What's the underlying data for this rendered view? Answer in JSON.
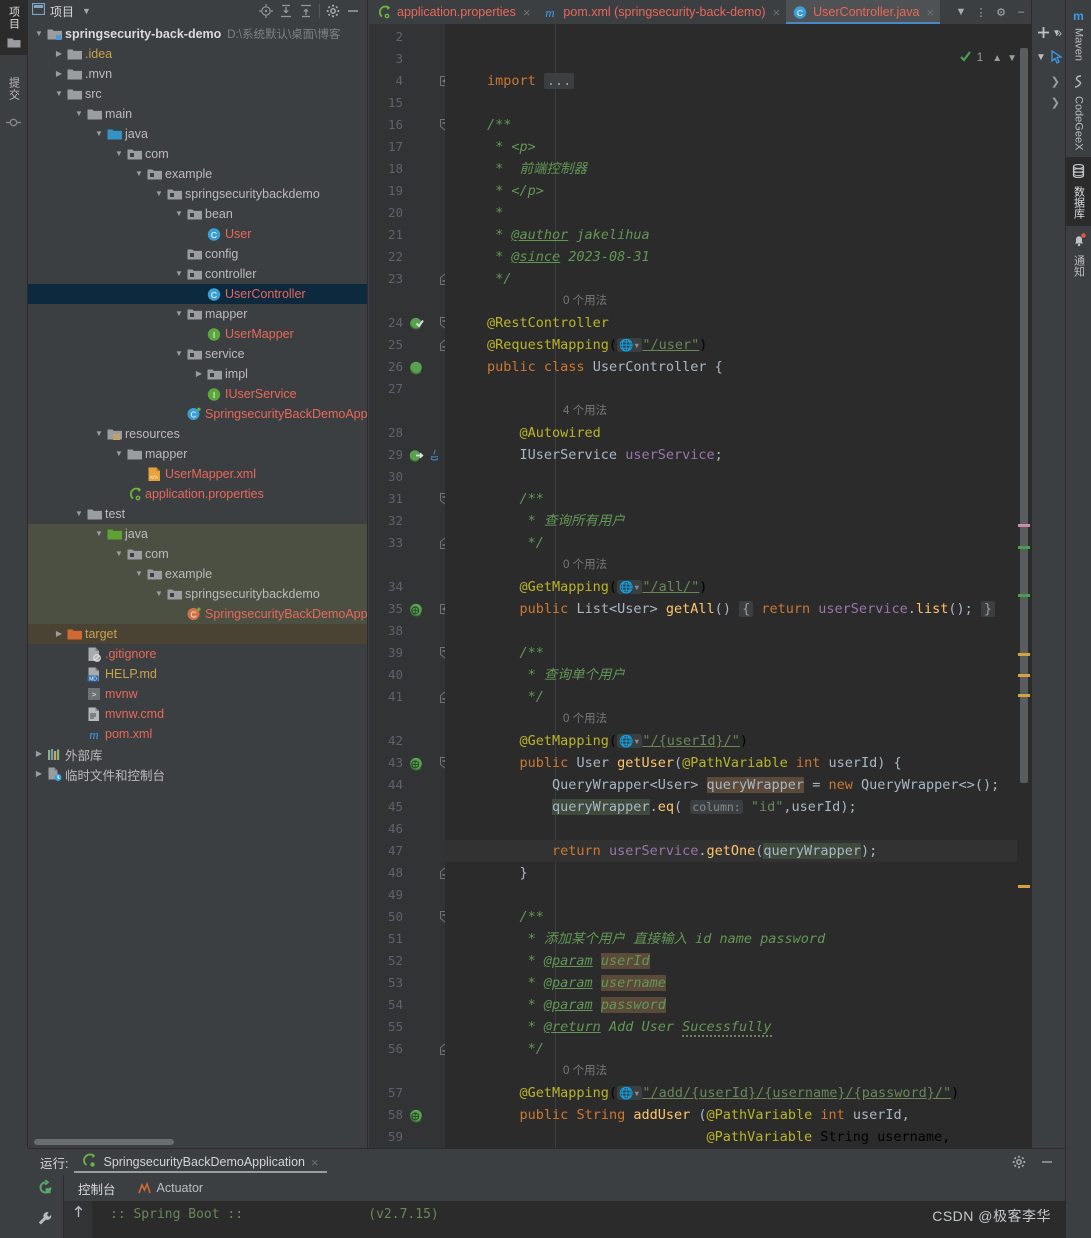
{
  "window": {
    "left_strip": [
      {
        "label": "项目",
        "icon": "project-icon",
        "active": true
      },
      {
        "label": "提交",
        "icon": "commit-icon",
        "active": false
      }
    ],
    "right_strip": [
      {
        "label": "Maven",
        "icon": "maven-icon"
      },
      {
        "label": "CodeGeeX",
        "icon": "codegeex-icon"
      },
      {
        "label": "数据库",
        "icon": "database-icon"
      },
      {
        "label": "通知",
        "icon": "bell-icon"
      }
    ]
  },
  "project_panel": {
    "title": "项目",
    "toolbar_icons": [
      "locate-icon",
      "expand-all-icon",
      "collapse-all-icon",
      "gear-icon",
      "minimize-icon"
    ],
    "tree": [
      {
        "depth": 0,
        "arrow": "down",
        "icon": "module-icon",
        "label": "springsecurity-back-demo",
        "sub": "D:\\系统默认\\桌面\\博客",
        "style": "bold"
      },
      {
        "depth": 1,
        "arrow": "right",
        "icon": "folder-icon",
        "label": ".idea",
        "style": "yellow"
      },
      {
        "depth": 1,
        "arrow": "right",
        "icon": "folder-icon",
        "label": ".mvn",
        "style": "plain"
      },
      {
        "depth": 1,
        "arrow": "down",
        "icon": "folder-icon",
        "label": "src",
        "style": "plain"
      },
      {
        "depth": 2,
        "arrow": "down",
        "icon": "folder-icon",
        "label": "main",
        "style": "plain"
      },
      {
        "depth": 3,
        "arrow": "down",
        "icon": "source-root-icon",
        "label": "java",
        "style": "plain"
      },
      {
        "depth": 4,
        "arrow": "down",
        "icon": "package-icon",
        "label": "com",
        "style": "plain"
      },
      {
        "depth": 5,
        "arrow": "down",
        "icon": "package-icon",
        "label": "example",
        "style": "plain"
      },
      {
        "depth": 6,
        "arrow": "down",
        "icon": "package-icon",
        "label": "springsecuritybackdemo",
        "style": "plain"
      },
      {
        "depth": 7,
        "arrow": "down",
        "icon": "package-icon",
        "label": "bean",
        "style": "plain"
      },
      {
        "depth": 8,
        "arrow": "none",
        "icon": "class-icon",
        "label": "User",
        "style": "salmon"
      },
      {
        "depth": 7,
        "arrow": "none",
        "icon": "package-icon",
        "label": "config",
        "style": "plain"
      },
      {
        "depth": 7,
        "arrow": "down",
        "icon": "package-icon",
        "label": "controller",
        "style": "plain"
      },
      {
        "depth": 8,
        "arrow": "none",
        "icon": "class-icon",
        "label": "UserController",
        "style": "salmon",
        "selected": true
      },
      {
        "depth": 7,
        "arrow": "down",
        "icon": "package-icon",
        "label": "mapper",
        "style": "plain"
      },
      {
        "depth": 8,
        "arrow": "none",
        "icon": "interface-icon",
        "label": "UserMapper",
        "style": "salmon"
      },
      {
        "depth": 7,
        "arrow": "down",
        "icon": "package-icon",
        "label": "service",
        "style": "plain"
      },
      {
        "depth": 8,
        "arrow": "right",
        "icon": "package-icon",
        "label": "impl",
        "style": "plain"
      },
      {
        "depth": 8,
        "arrow": "none",
        "icon": "interface-icon",
        "label": "IUserService",
        "style": "salmon"
      },
      {
        "depth": 7,
        "arrow": "none",
        "icon": "spring-class-icon",
        "label": "SpringsecurityBackDemoApp",
        "style": "salmon"
      },
      {
        "depth": 3,
        "arrow": "down",
        "icon": "resource-root-icon",
        "label": "resources",
        "style": "plain"
      },
      {
        "depth": 4,
        "arrow": "down",
        "icon": "folder-icon",
        "label": "mapper",
        "style": "plain"
      },
      {
        "depth": 5,
        "arrow": "none",
        "icon": "xml-icon",
        "label": "UserMapper.xml",
        "style": "salmon"
      },
      {
        "depth": 4,
        "arrow": "none",
        "icon": "spring-properties-icon",
        "label": "application.properties",
        "style": "salmon"
      },
      {
        "depth": 2,
        "arrow": "down",
        "icon": "folder-icon",
        "label": "test",
        "style": "plain"
      },
      {
        "depth": 3,
        "arrow": "down",
        "icon": "test-source-root-icon",
        "label": "java",
        "style": "plain",
        "scope": "test"
      },
      {
        "depth": 4,
        "arrow": "down",
        "icon": "package-icon",
        "label": "com",
        "style": "plain",
        "scope": "test"
      },
      {
        "depth": 5,
        "arrow": "down",
        "icon": "package-icon",
        "label": "example",
        "style": "plain",
        "scope": "test"
      },
      {
        "depth": 6,
        "arrow": "down",
        "icon": "package-icon",
        "label": "springsecuritybackdemo",
        "style": "plain",
        "scope": "test"
      },
      {
        "depth": 7,
        "arrow": "none",
        "icon": "spring-test-class-icon",
        "label": "SpringsecurityBackDemoApp",
        "style": "salmon",
        "scope": "test"
      },
      {
        "depth": 1,
        "arrow": "right",
        "icon": "target-folder-icon",
        "label": "target",
        "style": "yellow",
        "highlight": true
      },
      {
        "depth": 2,
        "arrow": "none",
        "icon": "gitignore-icon",
        "label": ".gitignore",
        "style": "salmon"
      },
      {
        "depth": 2,
        "arrow": "none",
        "icon": "markdown-icon",
        "label": "HELP.md",
        "style": "yellow"
      },
      {
        "depth": 2,
        "arrow": "none",
        "icon": "script-icon",
        "label": "mvnw",
        "style": "salmon"
      },
      {
        "depth": 2,
        "arrow": "none",
        "icon": "cmd-icon",
        "label": "mvnw.cmd",
        "style": "salmon"
      },
      {
        "depth": 2,
        "arrow": "none",
        "icon": "maven-pom-icon",
        "label": "pom.xml",
        "style": "salmon"
      },
      {
        "depth": 0,
        "arrow": "right",
        "icon": "external-libraries-icon",
        "label": "外部库",
        "style": "plain"
      },
      {
        "depth": 0,
        "arrow": "right",
        "icon": "scratches-icon",
        "label": "临时文件和控制台",
        "style": "plain"
      }
    ]
  },
  "editor": {
    "tabs": [
      {
        "label": "application.properties",
        "icon": "spring-properties-icon",
        "active": false
      },
      {
        "label": "pom.xml (springsecurity-back-demo)",
        "icon": "maven-pom-icon",
        "active": false
      },
      {
        "label": "UserController.java",
        "icon": "class-icon",
        "active": true
      }
    ],
    "tab_actions": [
      "chevron-down-icon",
      "more-options-icon",
      "gear-icon",
      "minimize-icon"
    ],
    "inspection": {
      "count": "1",
      "status": "ok"
    },
    "lines": [
      {
        "n": "2",
        "text": ""
      },
      {
        "n": "3",
        "text": ""
      },
      {
        "n": "4",
        "text": "import ..."
      },
      {
        "n": "15",
        "text": ""
      },
      {
        "n": "16",
        "text": "/**"
      },
      {
        "n": "17",
        "text": " * <p>"
      },
      {
        "n": "18",
        "text": " *  前端控制器"
      },
      {
        "n": "19",
        "text": " * </p>"
      },
      {
        "n": "20",
        "text": " *"
      },
      {
        "n": "21",
        "text": " * @author jakelihua"
      },
      {
        "n": "22",
        "text": " * @since 2023-08-31"
      },
      {
        "n": "23",
        "text": " */"
      },
      {
        "n": "",
        "text": "0 个用法",
        "kind": "usage"
      },
      {
        "n": "24",
        "text": "@RestController"
      },
      {
        "n": "25",
        "text": "@RequestMapping(\"/user\")"
      },
      {
        "n": "26",
        "text": "public class UserController {"
      },
      {
        "n": "27",
        "text": ""
      },
      {
        "n": "",
        "text": "4 个用法",
        "kind": "usage"
      },
      {
        "n": "28",
        "text": "    @Autowired"
      },
      {
        "n": "29",
        "text": "    IUserService userService;"
      },
      {
        "n": "30",
        "text": ""
      },
      {
        "n": "31",
        "text": "    /**"
      },
      {
        "n": "32",
        "text": "     * 查询所有用户"
      },
      {
        "n": "33",
        "text": "     */"
      },
      {
        "n": "",
        "text": "0 个用法",
        "kind": "usage"
      },
      {
        "n": "34",
        "text": "    @GetMapping(\"/all/\")"
      },
      {
        "n": "35",
        "text": "    public List<User> getAll() { return userService.list(); }"
      },
      {
        "n": "38",
        "text": ""
      },
      {
        "n": "39",
        "text": "    /**"
      },
      {
        "n": "40",
        "text": "     * 查询单个用户"
      },
      {
        "n": "41",
        "text": "     */"
      },
      {
        "n": "",
        "text": "0 个用法",
        "kind": "usage"
      },
      {
        "n": "42",
        "text": "    @GetMapping(\"/{userId}/\")"
      },
      {
        "n": "43",
        "text": "    public User getUser(@PathVariable int userId) {"
      },
      {
        "n": "44",
        "text": "        QueryWrapper<User> queryWrapper = new QueryWrapper<>();"
      },
      {
        "n": "45",
        "text": "        queryWrapper.eq( column: \"id\",userId);"
      },
      {
        "n": "46",
        "text": ""
      },
      {
        "n": "47",
        "text": "        return userService.getOne(queryWrapper);",
        "current": true
      },
      {
        "n": "48",
        "text": "    }"
      },
      {
        "n": "49",
        "text": ""
      },
      {
        "n": "50",
        "text": "    /**"
      },
      {
        "n": "51",
        "text": "     * 添加某个用户 直接输入 id name password"
      },
      {
        "n": "52",
        "text": "     * @param userId"
      },
      {
        "n": "53",
        "text": "     * @param username"
      },
      {
        "n": "54",
        "text": "     * @param password"
      },
      {
        "n": "55",
        "text": "     * @return Add User Sucessfully"
      },
      {
        "n": "56",
        "text": "     */"
      },
      {
        "n": "",
        "text": "0 个用法",
        "kind": "usage"
      },
      {
        "n": "57",
        "text": "    @GetMapping(\"/add/{userId}/{username}/{password}/\")"
      },
      {
        "n": "58",
        "text": "    public String addUser (@PathVariable int userId,"
      },
      {
        "n": "59",
        "text": "                           @PathVariable String username,"
      }
    ]
  },
  "run_panel": {
    "label": "运行:",
    "configuration": "SpringsecurityBackDemoApplication",
    "tabs": [
      {
        "label": "控制台",
        "active": true
      },
      {
        "label": "Actuator",
        "icon": "actuator-icon",
        "active": false
      }
    ],
    "left_icons": [
      "rerun-icon",
      "wrench-icon"
    ],
    "console_scroll_icon": "scroll-up-icon",
    "console_text": ":: Spring Boot ::                (v2.7.15)"
  },
  "watermark": "CSDN @极客李华",
  "colors": {
    "accent_blue": "#4a88c7",
    "selection_blue": "#0d293e",
    "editor_bg": "#2b2b2b",
    "panel_bg": "#3c3f41",
    "salmon": "#e8685b",
    "string_green": "#6a8759",
    "annotation_yellow": "#bbb529",
    "keyword_orange": "#cc7832"
  }
}
